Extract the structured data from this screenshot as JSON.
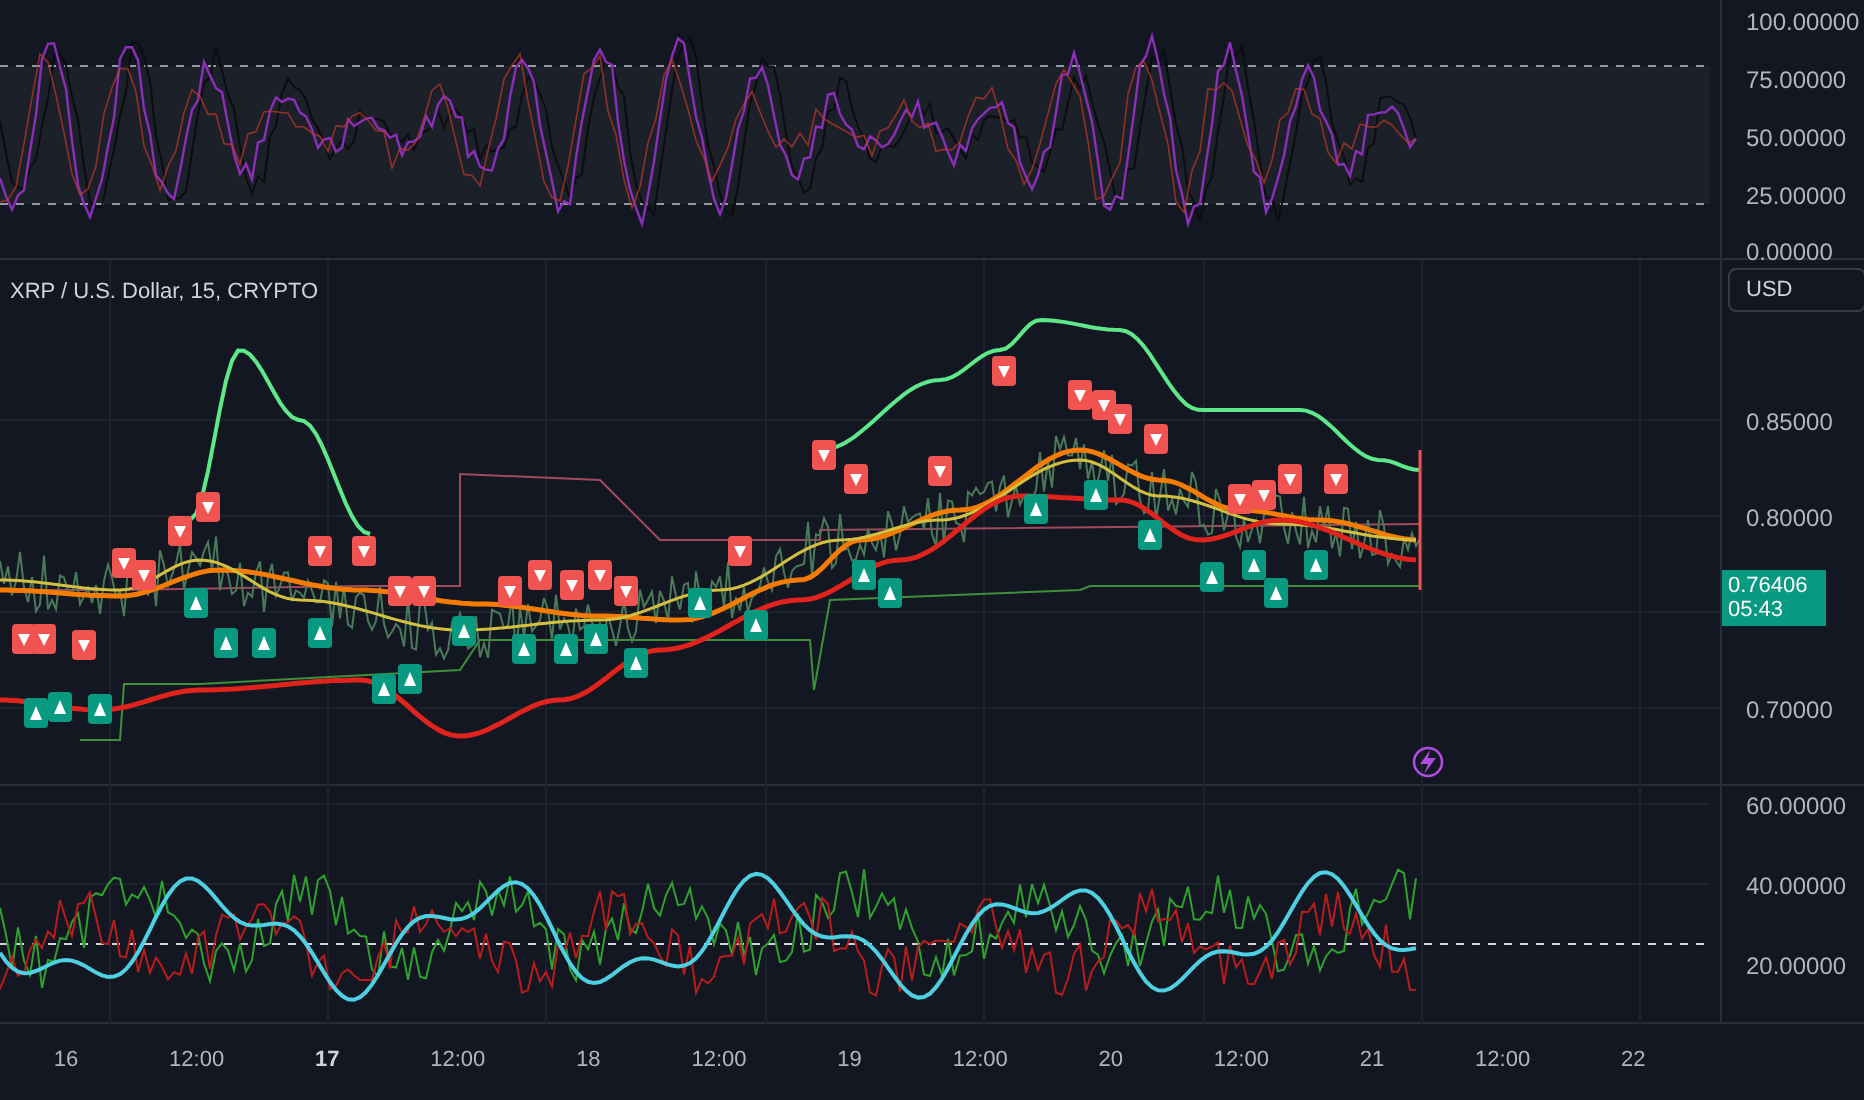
{
  "chart_title": "XRP / U.S. Dollar, 15, CRYPTO",
  "top_pane": {
    "axis_labels": [
      "100.00000",
      "75.00000",
      "50.00000",
      "25.00000",
      "0.00000"
    ]
  },
  "main_pane": {
    "currency_button": "USD",
    "axis_labels": [
      "0.85000",
      "0.80000",
      "0.70000"
    ],
    "price_tag": {
      "price": "0.76406",
      "countdown": "05:43"
    }
  },
  "bottom_pane": {
    "axis_labels": [
      "60.00000",
      "40.00000",
      "20.00000"
    ]
  },
  "time_axis": [
    {
      "label": "16",
      "emphasized": false
    },
    {
      "label": "12:00",
      "emphasized": false
    },
    {
      "label": "17",
      "emphasized": true
    },
    {
      "label": "12:00",
      "emphasized": false
    },
    {
      "label": "18",
      "emphasized": false
    },
    {
      "label": "12:00",
      "emphasized": false
    },
    {
      "label": "19",
      "emphasized": false
    },
    {
      "label": "12:00",
      "emphasized": false
    },
    {
      "label": "20",
      "emphasized": false
    },
    {
      "label": "12:00",
      "emphasized": false
    },
    {
      "label": "21",
      "emphasized": false
    },
    {
      "label": "12:00",
      "emphasized": false
    },
    {
      "label": "22",
      "emphasized": false
    }
  ]
}
